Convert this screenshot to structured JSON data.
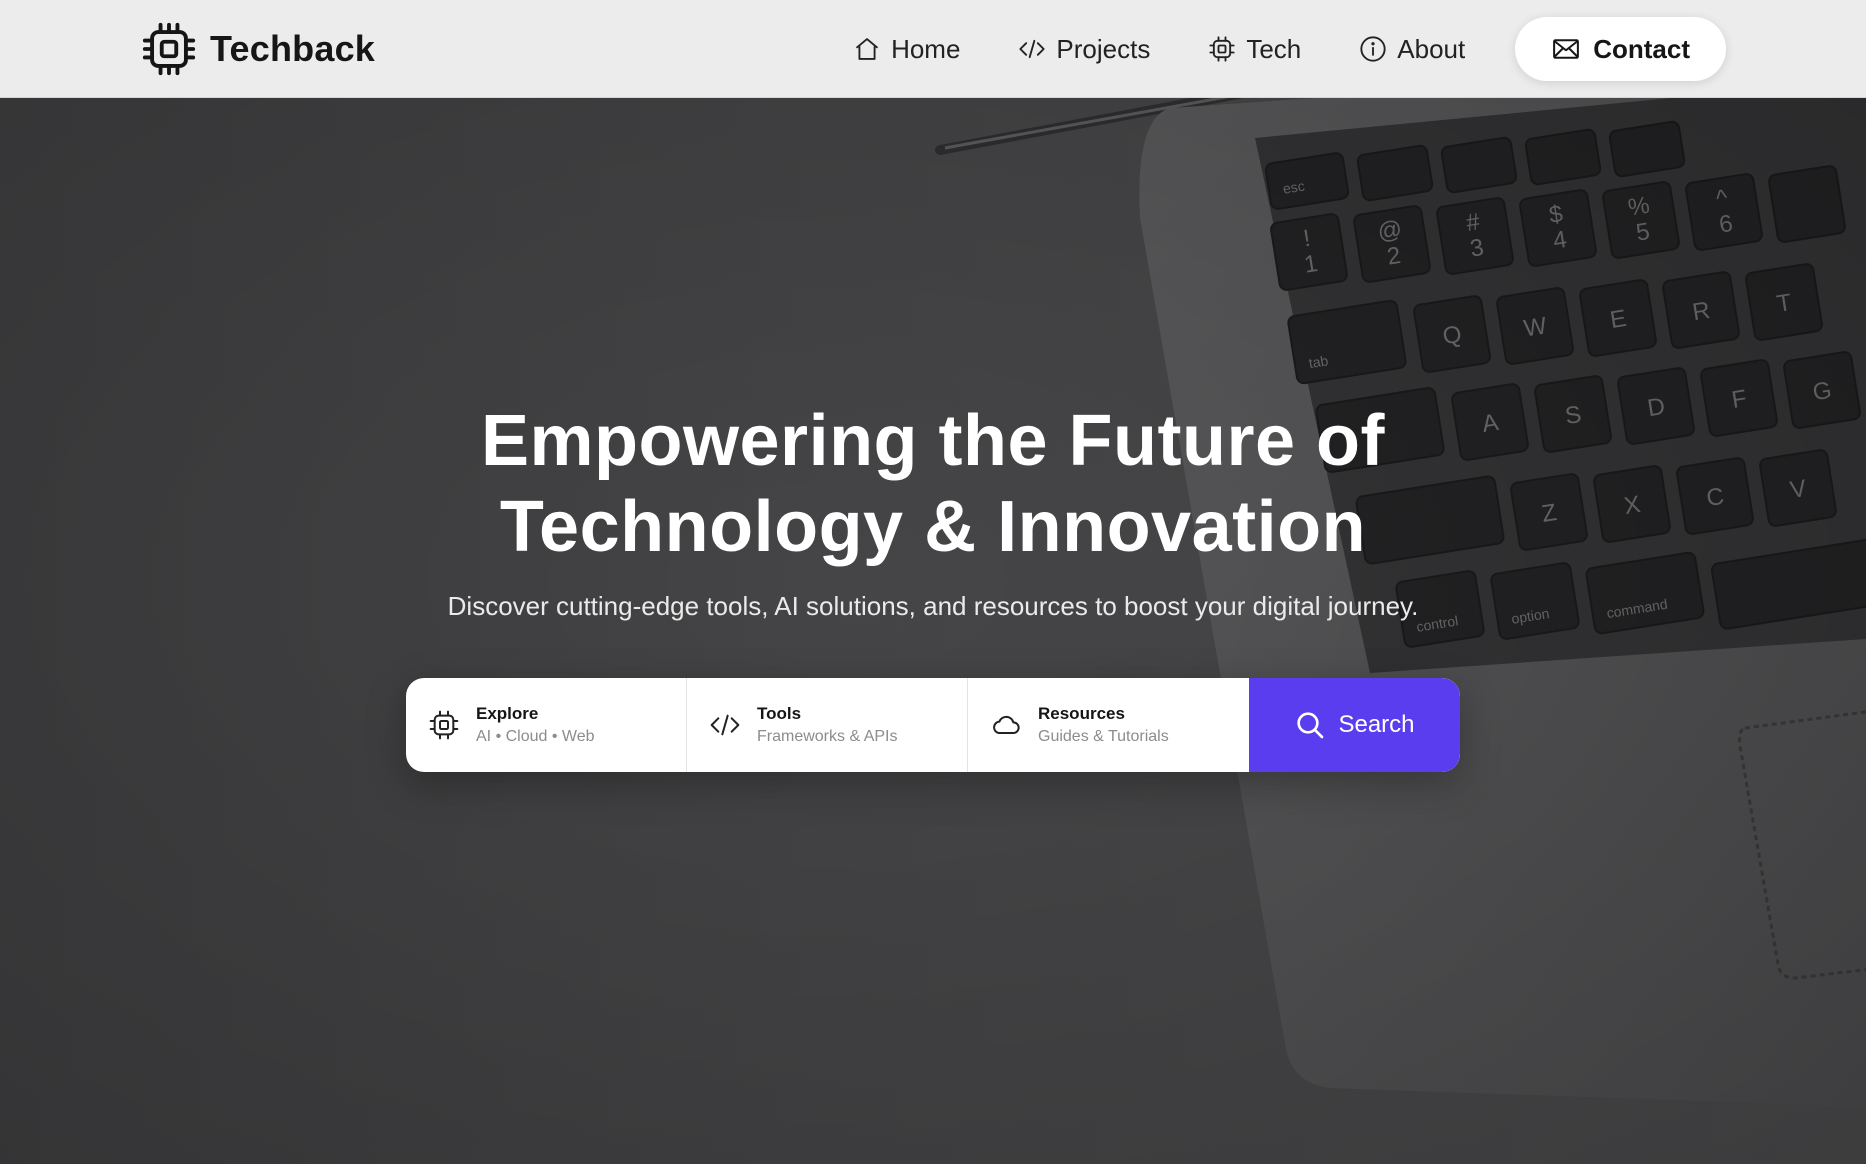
{
  "brand": {
    "name": "Techback",
    "logo_icon": "chip-icon"
  },
  "nav": {
    "items": [
      {
        "label": "Home",
        "icon": "home-icon"
      },
      {
        "label": "Projects",
        "icon": "code-icon"
      },
      {
        "label": "Tech",
        "icon": "chip-icon"
      },
      {
        "label": "About",
        "icon": "info-icon"
      }
    ],
    "contact": {
      "label": "Contact",
      "icon": "mail-icon"
    }
  },
  "hero": {
    "title_line1": "Empowering the Future of",
    "title_line2": "Technology & Innovation",
    "subtitle": "Discover cutting-edge tools, AI solutions, and resources to boost your digital journey."
  },
  "search": {
    "segments": [
      {
        "title": "Explore",
        "subtitle": "AI • Cloud • Web",
        "icon": "chip-icon"
      },
      {
        "title": "Tools",
        "subtitle": "Frameworks & APIs",
        "icon": "code-icon"
      },
      {
        "title": "Resources",
        "subtitle": "Guides & Tutorials",
        "icon": "cloud-icon"
      }
    ],
    "button": {
      "label": "Search",
      "icon": "search-icon"
    }
  },
  "keyboard_keys": [
    "esc",
    "!",
    "1",
    "@",
    "2",
    "#",
    "3",
    "$",
    "4",
    "%",
    "5",
    "^",
    "6",
    "tab",
    "Q",
    "W",
    "E",
    "R",
    "T",
    "A",
    "S",
    "D",
    "F",
    "G",
    "Z",
    "X",
    "C",
    "V",
    "control",
    "option",
    "command"
  ],
  "colors": {
    "accent": "#5b3df0",
    "header_bg": "#ececec",
    "hero_bg": "#444446"
  }
}
